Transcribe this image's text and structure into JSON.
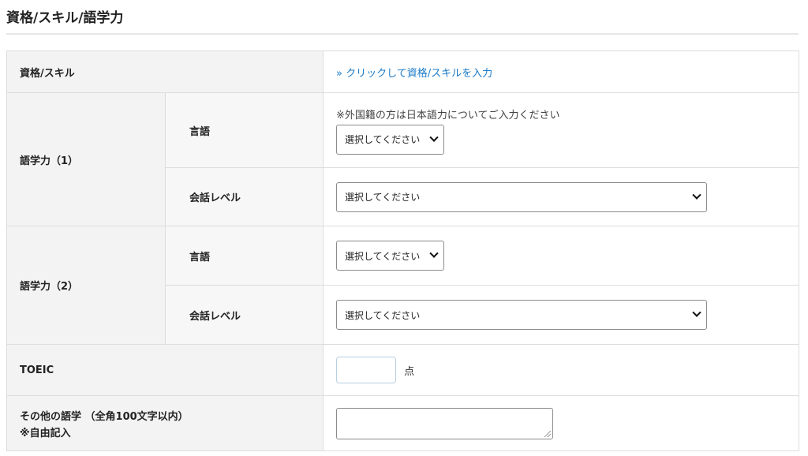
{
  "section": {
    "title": "資格/スキル/語学力"
  },
  "skills": {
    "label": "資格/スキル",
    "link_text": "» クリックして資格/スキルを入力"
  },
  "language1": {
    "label": "語学力（1）",
    "language_label": "言語",
    "note": "※外国籍の方は日本語力についてご入力ください",
    "language_select": "選択してください",
    "level_label": "会話レベル",
    "level_select": "選択してください"
  },
  "language2": {
    "label": "語学力（2）",
    "language_label": "言語",
    "language_select": "選択してください",
    "level_label": "会話レベル",
    "level_select": "選択してください"
  },
  "toeic": {
    "label": "TOEIC",
    "value": "",
    "unit": "点"
  },
  "other_language": {
    "label": "その他の語学 （全角100文字以内）",
    "label_note": "※自由記入",
    "value": ""
  },
  "colors": {
    "link": "#1a7ac8",
    "header_bg": "#f3f3f3",
    "border": "#dddddd"
  }
}
